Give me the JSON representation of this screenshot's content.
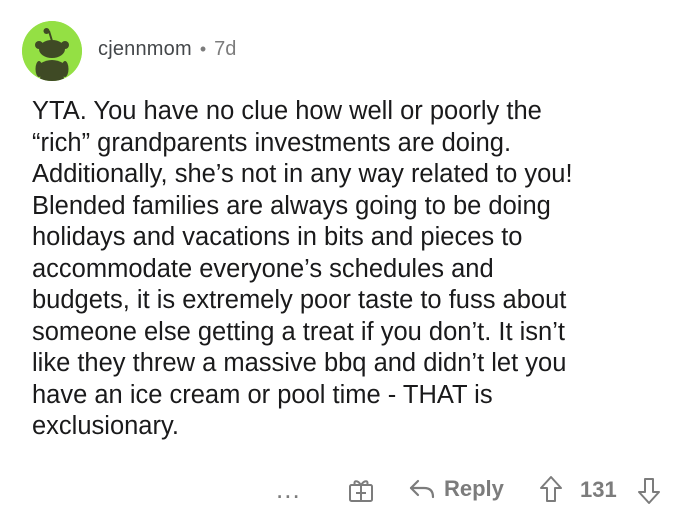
{
  "comment": {
    "username": "cjennmom",
    "separator": "•",
    "age": "7d",
    "body": "YTA. You have no clue how well or poorly the\n“rich” grandparents investments are doing.\nAdditionally, she’s not in any way related to you!\nBlended families are always going to be doing\nholidays and vacations in bits and pieces to\naccommodate everyone’s schedules and\nbudgets, it is extremely poor taste to fuss about\nsomeone else getting a treat if you don’t. It isn’t\nlike they threw a massive bbq and didn’t let you\nhave an ice cream or pool time - THAT is\nexclusionary.",
    "avatar_color": "#94e044"
  },
  "actions": {
    "more_label": "...",
    "award_icon": "gift-icon",
    "reply_icon": "reply-arrow-icon",
    "reply_label": "Reply",
    "upvote_icon": "upvote-arrow-icon",
    "score": "131",
    "downvote_icon": "downvote-arrow-icon"
  },
  "colors": {
    "text": "#1a1a1b",
    "muted": "#7c7c7c",
    "username": "#44474a"
  }
}
